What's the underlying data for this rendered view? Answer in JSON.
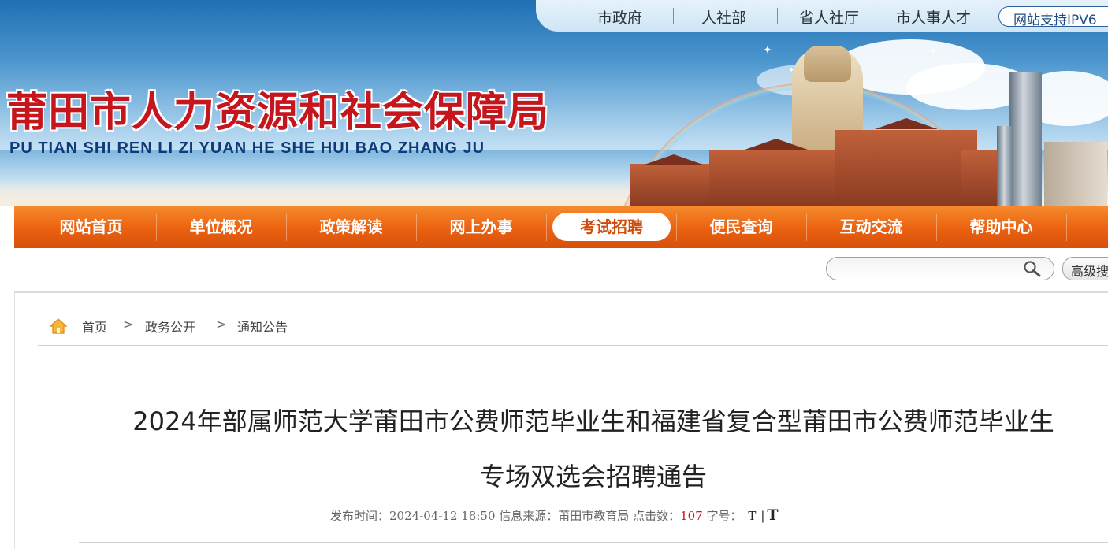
{
  "top_links": [
    {
      "label": "市政府"
    },
    {
      "label": "人社部"
    },
    {
      "label": "省人社厅"
    },
    {
      "label": "市人事人才"
    }
  ],
  "ipv6_label": "网站支持IPV6",
  "site": {
    "title_cn": "莆田市人力资源和社会保障局",
    "title_pinyin": "PU TIAN SHI REN LI ZI YUAN HE SHE HUI BAO ZHANG JU"
  },
  "nav": [
    {
      "label": "网站首页"
    },
    {
      "label": "单位概况"
    },
    {
      "label": "政策解读"
    },
    {
      "label": "网上办事"
    },
    {
      "label": "考试招聘"
    },
    {
      "label": "便民查询"
    },
    {
      "label": "互动交流"
    },
    {
      "label": "帮助中心"
    }
  ],
  "nav_active_index": 4,
  "search": {
    "value": "",
    "advanced_label": "高级搜索"
  },
  "breadcrumb": [
    {
      "label": "首页"
    },
    {
      "label": "政务公开"
    },
    {
      "label": "通知公告"
    }
  ],
  "breadcrumb_separator": ">",
  "article": {
    "title_line1": "2024年部属师范大学莆田市公费师范毕业生和福建省复合型莆田市公费师范毕业生",
    "title_line2": "专场双选会招聘通告",
    "meta": {
      "publish_label": "发布时间：",
      "publish_time": "2024-04-12 18:50",
      "source_label": "信息来源：",
      "source": "莆田市教育局",
      "clicks_label": "点击数：",
      "clicks": "107",
      "fontsize_label": "字号：",
      "font_small": "T",
      "font_sep": "|",
      "font_large": "T"
    }
  },
  "colors": {
    "brand_red": "#c4161c",
    "nav_orange": "#ea6110",
    "pinyin_blue": "#0e3a78"
  }
}
